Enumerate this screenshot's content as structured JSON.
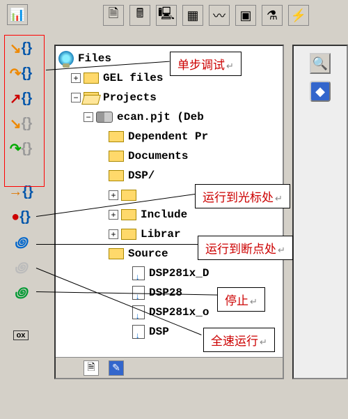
{
  "top_toolbar": {
    "icons": [
      "doc",
      "calc",
      "device",
      "grid",
      "wave",
      "chip",
      "flask",
      "action"
    ]
  },
  "side_buttons": [
    {
      "name": "glasses",
      "glyph": "👓"
    },
    {
      "name": "step-into",
      "glyph": "{}"
    },
    {
      "name": "step-over",
      "glyph": "{}"
    },
    {
      "name": "step-out",
      "glyph": "{}"
    },
    {
      "name": "step-asm",
      "glyph": "{}"
    },
    {
      "name": "step-return",
      "glyph": "{}"
    },
    {
      "name": "run-to-cursor",
      "glyph": "→{}"
    },
    {
      "name": "run-to-break",
      "glyph": "{}"
    },
    {
      "name": "run",
      "glyph": "≫"
    },
    {
      "name": "halt",
      "glyph": "≫"
    },
    {
      "name": "go",
      "glyph": "≫"
    },
    {
      "name": "var",
      "glyph": "▭"
    }
  ],
  "tree": {
    "root": "Files",
    "gel": "GEL files",
    "projects": "Projects",
    "project_name": "ecan.pjt (Deb",
    "folders": [
      "Dependent Pr",
      "Documents",
      "DSP/",
      "Include",
      "Librar",
      "Source"
    ],
    "srcfiles": [
      "DSP281x_D",
      "DSP28",
      "DSP281x_o",
      "DSP"
    ]
  },
  "callouts": {
    "step": "单步调试",
    "cursor": "运行到光标处",
    "breakpoint": "运行到断点处",
    "halt": "停止",
    "run": "全速运行"
  },
  "right": {
    "zoom": "🔍",
    "diamond": "◆"
  },
  "tabs": {
    "file": "🗎",
    "edit": "✎"
  },
  "top_left": {
    "chart": "📊"
  }
}
